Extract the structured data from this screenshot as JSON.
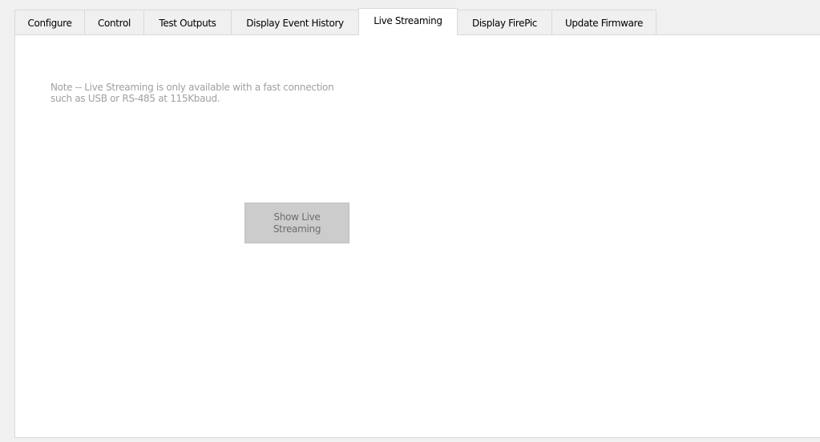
{
  "tabs": [
    {
      "label": "Configure",
      "active": false
    },
    {
      "label": "Control",
      "active": false
    },
    {
      "label": "Test Outputs",
      "active": false
    },
    {
      "label": "Display Event History",
      "active": false
    },
    {
      "label": "Live Streaming",
      "active": true
    },
    {
      "label": "Display FirePic",
      "active": false
    },
    {
      "label": "Update Firmware",
      "active": false
    }
  ],
  "live_streaming": {
    "note_line1": "Note -- Live Streaming is only available with a fast connection",
    "note_line2": "such as USB or RS-485 at 115Kbaud.",
    "button_line1": "Show Live",
    "button_line2": "Streaming",
    "button_enabled": false
  },
  "colors": {
    "window_bg": "#f0f0f0",
    "panel_bg": "#ffffff",
    "border": "#d9d9d9",
    "note_text": "#a0a0a0",
    "button_bg_disabled": "#cccccc",
    "button_text_disabled": "#6d6d6d"
  }
}
